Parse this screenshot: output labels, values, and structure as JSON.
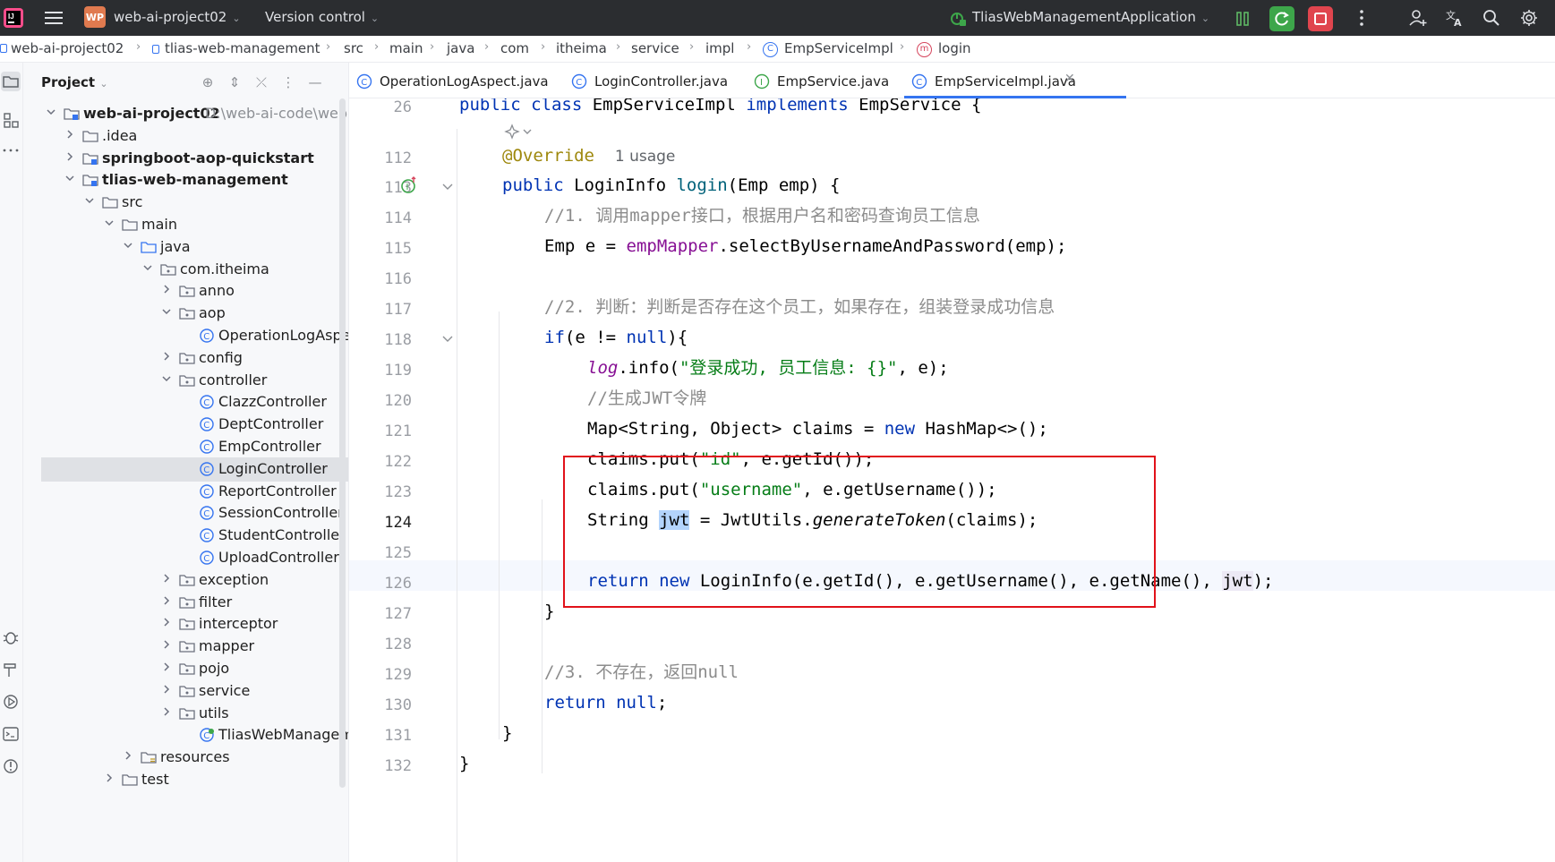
{
  "titlebar": {
    "project_badge": "WP",
    "project_name": "web-ai-project02",
    "vcs_label": "Version control",
    "run_config": "TliasWebManagementApplication"
  },
  "breadcrumb": [
    "web-ai-project02",
    "tlias-web-management",
    "src",
    "main",
    "java",
    "com",
    "itheima",
    "service",
    "impl",
    "EmpServiceImpl",
    "login"
  ],
  "project_panel": {
    "title": "Project",
    "tree": [
      {
        "label": "web-ai-project02",
        "path": "D:\\web-ai-code\\web",
        "bold": true
      },
      {
        "label": ".idea"
      },
      {
        "label": "springboot-aop-quickstart",
        "bold": true
      },
      {
        "label": "tlias-web-management",
        "bold": true
      },
      {
        "label": "src"
      },
      {
        "label": "main"
      },
      {
        "label": "java"
      },
      {
        "label": "com.itheima"
      },
      {
        "label": "anno"
      },
      {
        "label": "aop"
      },
      {
        "label": "OperationLogAspect"
      },
      {
        "label": "config"
      },
      {
        "label": "controller"
      },
      {
        "label": "ClazzController"
      },
      {
        "label": "DeptController"
      },
      {
        "label": "EmpController"
      },
      {
        "label": "LoginController"
      },
      {
        "label": "ReportController"
      },
      {
        "label": "SessionController"
      },
      {
        "label": "StudentController"
      },
      {
        "label": "UploadController"
      },
      {
        "label": "exception"
      },
      {
        "label": "filter"
      },
      {
        "label": "interceptor"
      },
      {
        "label": "mapper"
      },
      {
        "label": "pojo"
      },
      {
        "label": "service"
      },
      {
        "label": "utils"
      },
      {
        "label": "TliasWebManagementApplication"
      },
      {
        "label": "resources"
      },
      {
        "label": "test"
      }
    ]
  },
  "tabs": [
    {
      "label": "OperationLogAspect.java"
    },
    {
      "label": "LoginController.java"
    },
    {
      "label": "EmpService.java"
    },
    {
      "label": "EmpServiceImpl.java",
      "active": true
    }
  ],
  "editor": {
    "line_numbers": [
      "26",
      "112",
      "113",
      "114",
      "115",
      "116",
      "117",
      "118",
      "119",
      "120",
      "121",
      "122",
      "123",
      "124",
      "125",
      "126",
      "127",
      "128",
      "129",
      "130",
      "131",
      "132"
    ],
    "current_line": "124",
    "usage_hint": "1 usage",
    "comment1": "//1. 调用mapper接口，根据用户名和密码查询员工信息",
    "comment2": "//2. 判断：判断是否存在这个员工，如果存在，组装登录成功信息",
    "comment3": "//生成JWT令牌",
    "comment4": "//3. 不存在，返回null",
    "log_msg": "\"登录成功, 员工信息: {}\"",
    "str_id": "\"id\"",
    "str_username": "\"username\""
  },
  "colors": {
    "accent": "#3574f0",
    "highlight_box": "#e1121a",
    "run_button": "#3da64a",
    "stop_button": "#e0454e"
  }
}
